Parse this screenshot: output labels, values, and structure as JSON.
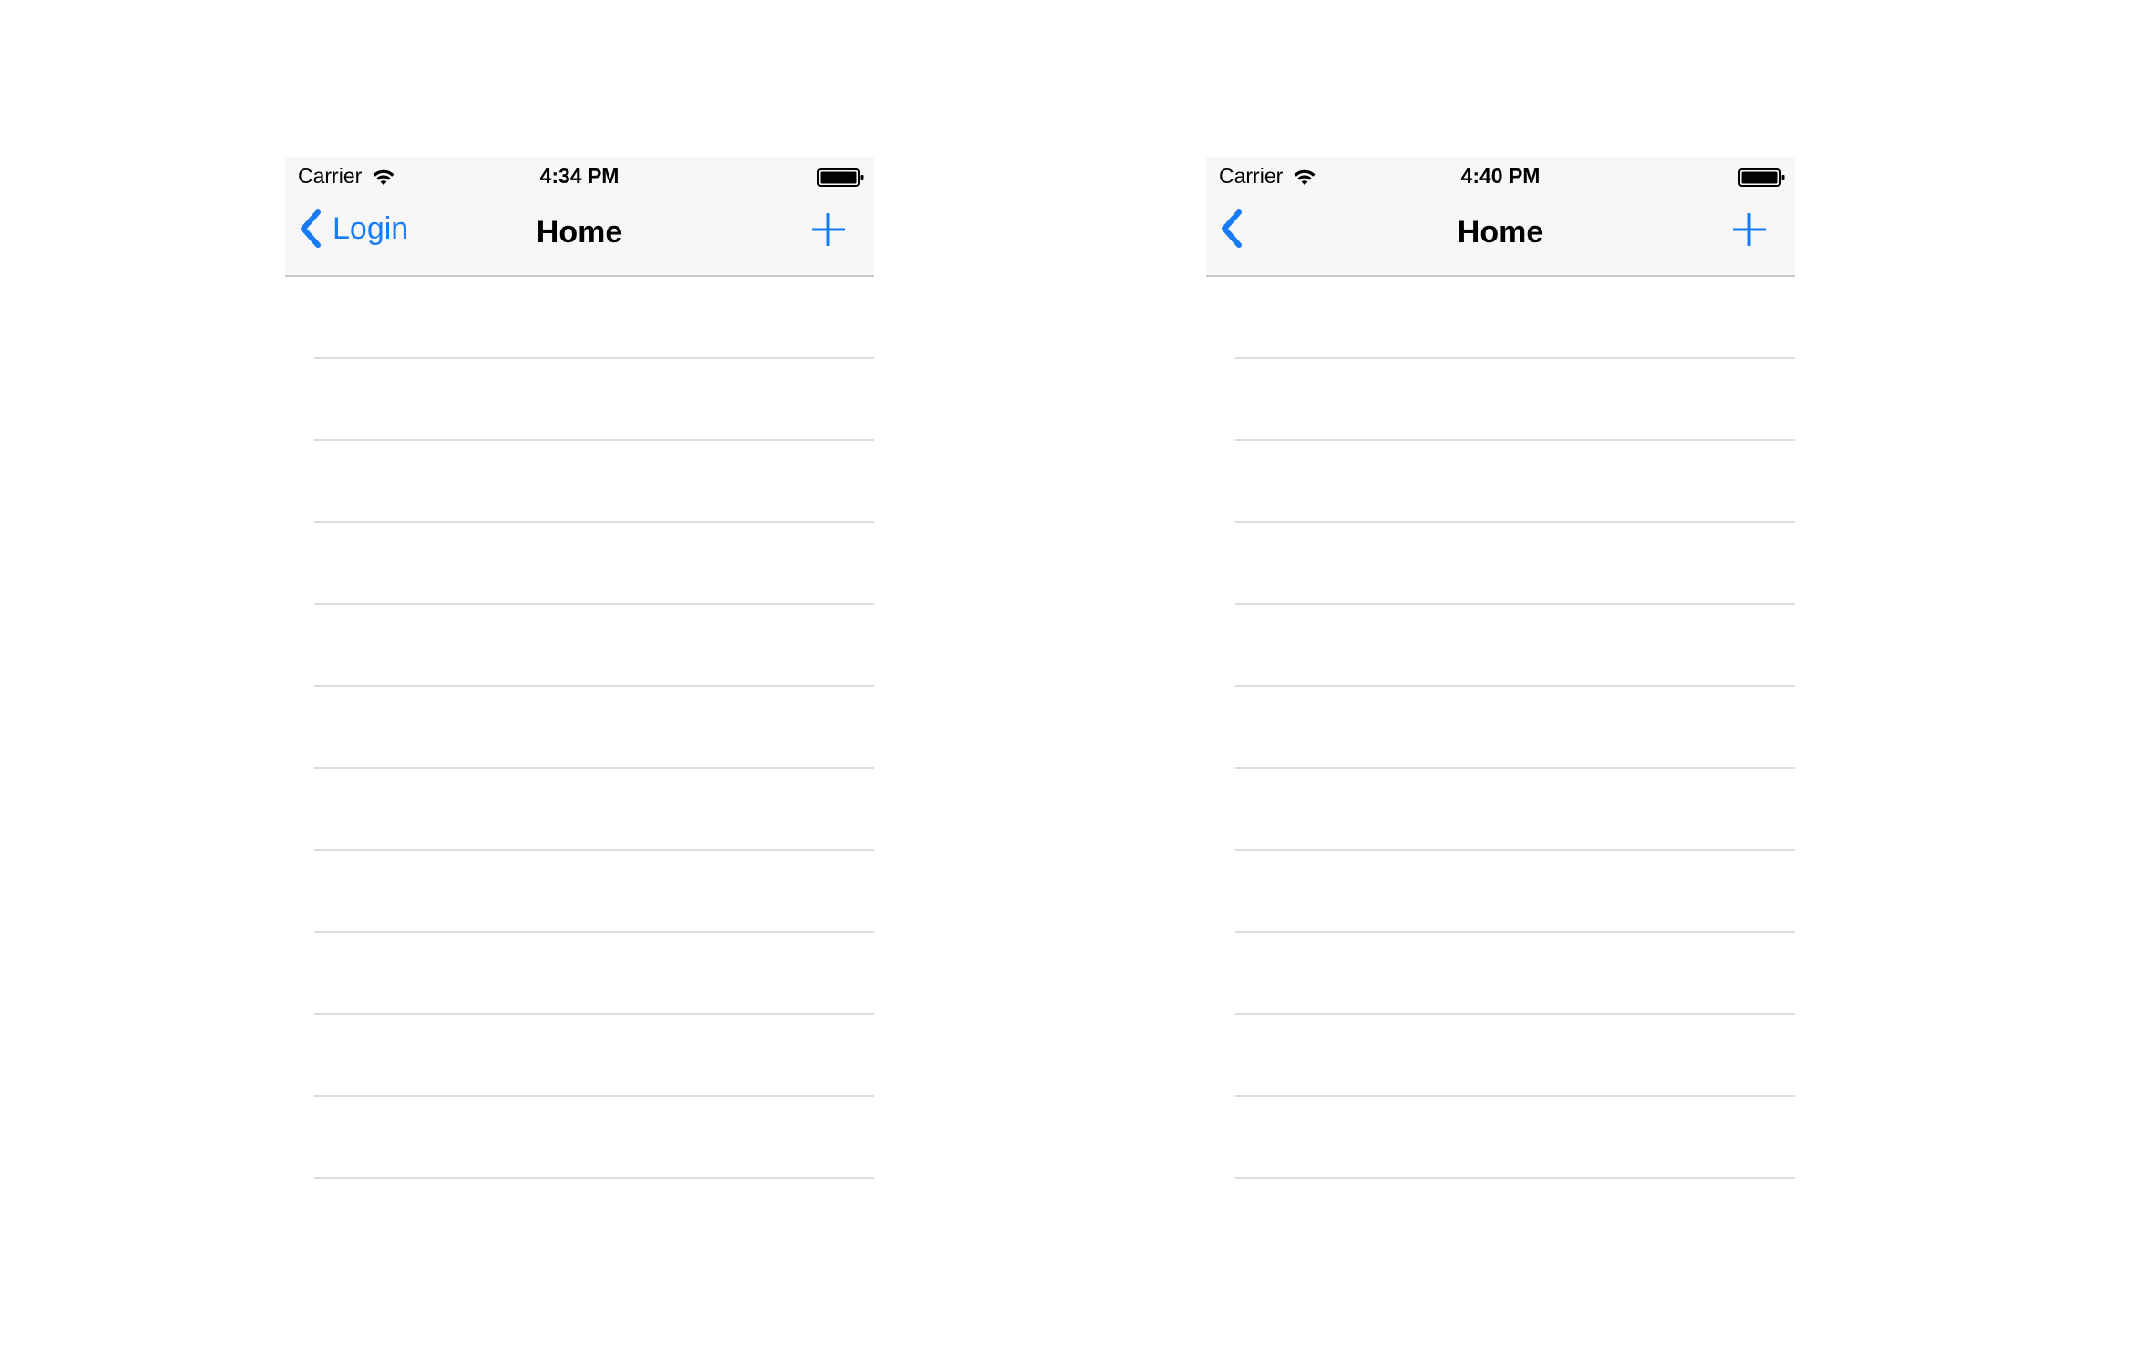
{
  "screens": [
    {
      "status_bar": {
        "carrier": "Carrier",
        "time": "4:34 PM"
      },
      "nav_bar": {
        "back_label": "Login",
        "title": "Home"
      },
      "row_count": 11
    },
    {
      "status_bar": {
        "carrier": "Carrier",
        "time": "4:40 PM"
      },
      "nav_bar": {
        "back_label": "",
        "title": "Home"
      },
      "row_count": 11
    }
  ],
  "icons": {
    "wifi": "wifi-icon",
    "battery": "battery-icon",
    "back": "chevron-left-icon",
    "add": "plus-icon"
  },
  "colors": {
    "tint": "#1a7cf5",
    "nav_background": "#f7f7f7",
    "separator": "#dcdcdc",
    "text": "#000000"
  }
}
